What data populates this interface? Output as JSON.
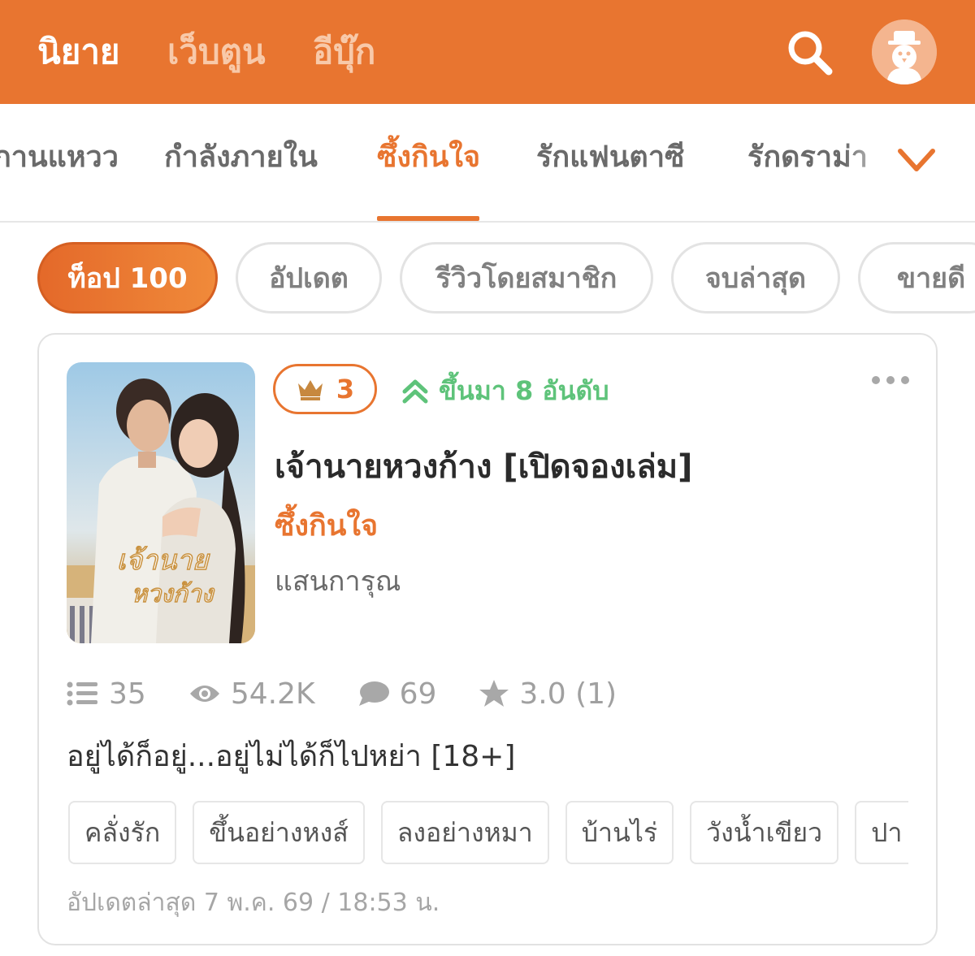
{
  "top_nav": {
    "tabs": [
      {
        "label": "นิยาย",
        "active": true
      },
      {
        "label": "เว็บตูน",
        "active": false
      },
      {
        "label": "อีบุ๊ก",
        "active": false
      }
    ],
    "search_icon": "search-icon",
    "avatar_icon": "avatar-icon"
  },
  "category_tabs": {
    "items": [
      "กานแหวว",
      "กำลังภายใน",
      "ซึ้งกินใจ",
      "รักแฟนตาซี",
      "รักดราม่า"
    ],
    "active": "ซึ้งกินใจ",
    "expand_icon": "chevron-down-icon"
  },
  "filters": {
    "items": [
      {
        "label": "ท็อป 100",
        "active": true
      },
      {
        "label": "อัปเดต",
        "active": false
      },
      {
        "label": "รีวิวโดยสมาชิก",
        "active": false
      },
      {
        "label": "จบล่าสุด",
        "active": false
      },
      {
        "label": "ขายดี",
        "active": false
      }
    ]
  },
  "card": {
    "rank": "3",
    "rank_change": "ขึ้นมา 8 อันดับ",
    "title": "เจ้านายหวงก้าง  [เปิดจองเล่ม]",
    "genre": "ซึ้งกินใจ",
    "author": "แสนการุณ",
    "stats": {
      "chapters": "35",
      "views": "54.2K",
      "comments": "69",
      "rating": "3.0 (1)"
    },
    "description": "อยู่ได้ก็อยู่...อยู่ไม่ได้ก็ไปหย่า [18+]",
    "tags": [
      "คลั่งรัก",
      "ขึ้นอย่างหงส์",
      "ลงอย่างหมา",
      "บ้านไร่",
      "วังน้ำเขียว",
      "ปา"
    ],
    "updated": "อัปเดตล่าสุด 7 พ.ค. 69 / 18:53 น."
  },
  "colors": {
    "brand": "#e87530",
    "up_green": "#5ec37a",
    "muted": "#a0a0a0"
  }
}
